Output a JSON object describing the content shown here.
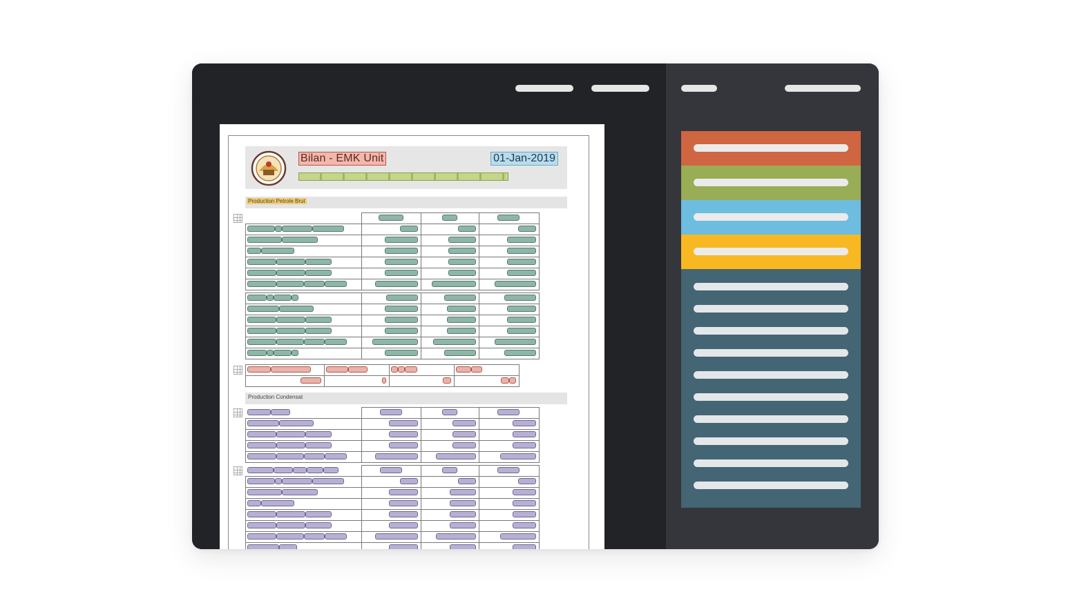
{
  "document": {
    "title": "Bilan - EMK Unit",
    "date": "01-Jan-2019",
    "section_1": "Production Petrole Brut",
    "section_2": "Production Condensat"
  },
  "colors": {
    "window_bg": "#222327",
    "sidebar_bg": "#34363b",
    "item_orange": "#cf6541",
    "item_green": "#98ad55",
    "item_blue": "#6cbde0",
    "item_yellow": "#f8b822",
    "list_panel": "#436574"
  }
}
